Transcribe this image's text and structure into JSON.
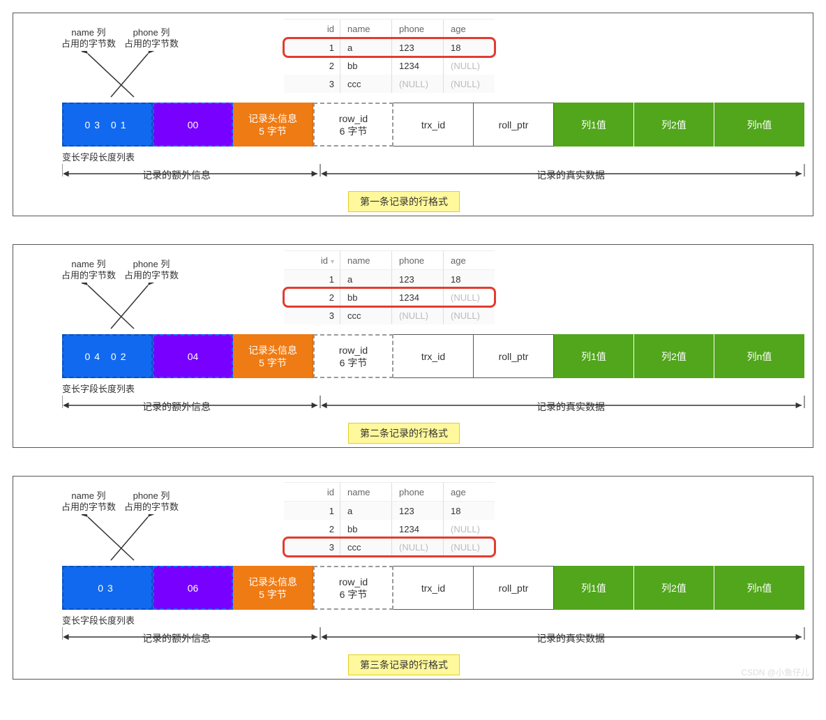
{
  "watermark": "CSDN @小鱼仔儿",
  "annot": {
    "name": "name 列\n占用的字节数",
    "phone": "phone 列\n占用的字节数"
  },
  "table_headers": [
    "id",
    "name",
    "phone",
    "age"
  ],
  "null_text": "(NULL)",
  "varlen_label": "变长字段长度列表",
  "brace_left": "记录的额外信息",
  "brace_right": "记录的真实数据",
  "cells": {
    "header": "记录头信息\n5 字节",
    "rowid": "row_id\n6 字节",
    "trxid": "trx_id",
    "rollptr": "roll_ptr",
    "col1": "列1值",
    "col2": "列2值",
    "coln": "列n值"
  },
  "panels": [
    {
      "caption": "第一条记录的行格式",
      "blue": "03   01",
      "purple": "00",
      "highlight": 0,
      "show_sort": false,
      "rows": [
        [
          "1",
          "a",
          "123",
          "18"
        ],
        [
          "2",
          "bb",
          "1234",
          "(NULL)"
        ],
        [
          "3",
          "ccc",
          "(NULL)",
          "(NULL)"
        ]
      ]
    },
    {
      "caption": "第二条记录的行格式",
      "blue": "04   02",
      "purple": "04",
      "highlight": 1,
      "show_sort": true,
      "rows": [
        [
          "1",
          "a",
          "123",
          "18"
        ],
        [
          "2",
          "bb",
          "1234",
          "(NULL)"
        ],
        [
          "3",
          "ccc",
          "(NULL)",
          "(NULL)"
        ]
      ]
    },
    {
      "caption": "第三条记录的行格式",
      "blue": "03",
      "purple": "06",
      "highlight": 2,
      "show_sort": false,
      "rows": [
        [
          "1",
          "a",
          "123",
          "18"
        ],
        [
          "2",
          "bb",
          "1234",
          "(NULL)"
        ],
        [
          "3",
          "ccc",
          "(NULL)",
          "(NULL)"
        ]
      ]
    }
  ]
}
